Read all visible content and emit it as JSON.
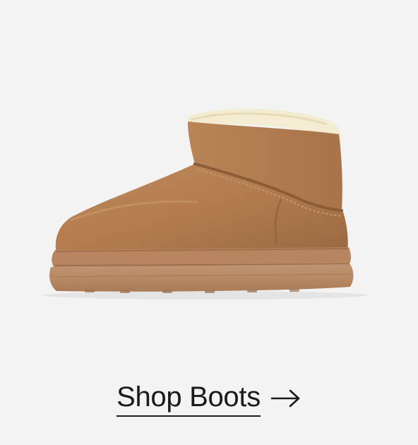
{
  "promo": {
    "product_image": "tan-suede-ankle-boot-image",
    "cta_label": "Shop Boots",
    "cta_icon": "arrow-right-icon"
  },
  "colors": {
    "background": "#f3f3f3",
    "suede": "#b07a4e",
    "sole": "#b98a65",
    "lining": "#f3ecd2",
    "text": "#1a1a1a"
  }
}
